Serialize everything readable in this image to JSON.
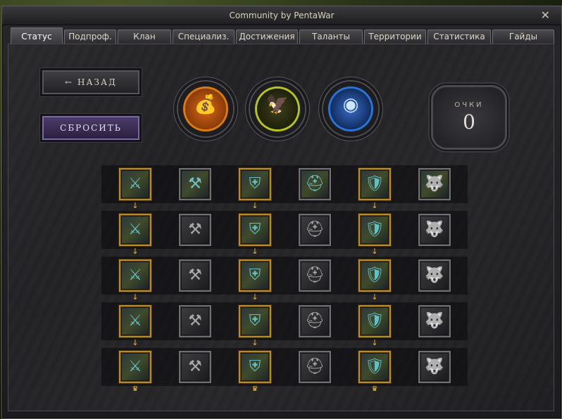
{
  "window": {
    "title": "Community by PentaWar",
    "close_glyph": "✕"
  },
  "tabs": [
    {
      "label": "Статус",
      "active": true
    },
    {
      "label": "Подпроф.",
      "active": false
    },
    {
      "label": "Клан",
      "active": false
    },
    {
      "label": "Специализ.",
      "active": false
    },
    {
      "label": "Достижения",
      "active": false
    },
    {
      "label": "Таланты",
      "active": false
    },
    {
      "label": "Территории",
      "active": false
    },
    {
      "label": "Статистика",
      "active": false
    },
    {
      "label": "Гайды",
      "active": false
    }
  ],
  "buttons": {
    "back": "← НАЗАД",
    "reset": "СБРОСИТЬ"
  },
  "emblems": [
    {
      "icon": "gold-treasure-icon",
      "glyph": "💰",
      "ring": "#e07a10",
      "core": "#8a3c08"
    },
    {
      "icon": "eagle-crest-icon",
      "glyph": "🦅",
      "ring": "#b7c41c",
      "core": "#2a2f12"
    },
    {
      "icon": "blue-orb-icon",
      "glyph": "◉",
      "ring": "#2a74d8",
      "core": "#0f2a5a"
    }
  ],
  "points": {
    "label": "ОЧКИ",
    "value": "0"
  },
  "skill_grid": {
    "columns": [
      {
        "icon": "claw-strike-icon",
        "glyph": "⚔",
        "tone": "gold",
        "color": "#5fc0c8"
      },
      {
        "icon": "hammer-upgrade-icon",
        "glyph": "⚒",
        "tone": "gray",
        "color": "#a9a9a9"
      },
      {
        "icon": "armor-boost-icon",
        "glyph": "⛨",
        "tone": "gold",
        "color": "#5fc0c8"
      },
      {
        "icon": "helmet-upgrade-icon",
        "glyph": "⛑",
        "tone": "gray",
        "color": "#a9a9a9"
      },
      {
        "icon": "shield-sword-icon",
        "glyph": "🛡",
        "tone": "gold",
        "color": "#5fc0c8"
      },
      {
        "icon": "beast-mask-icon",
        "glyph": "🐺",
        "tone": "gray",
        "color": "#a9a9a9"
      }
    ],
    "rows": 5,
    "arrow_glyph": "↓",
    "crown_glyph": "♛",
    "first_row_colored": [
      true,
      true,
      true,
      true,
      true,
      true
    ],
    "accent_gold": "#b88a2e"
  }
}
